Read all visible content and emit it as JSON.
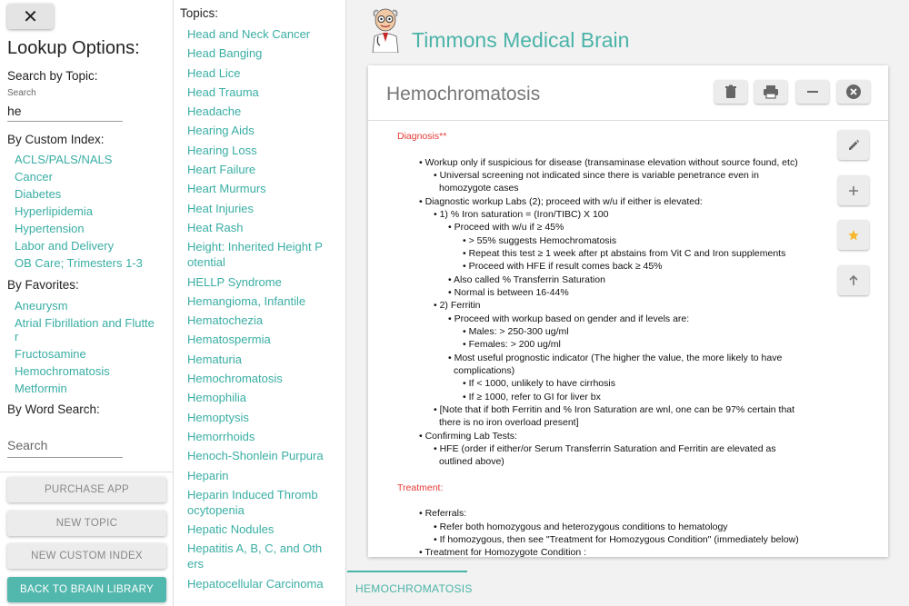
{
  "left": {
    "close_label": "✕",
    "title": "Lookup Options:",
    "search_topic_label": "Search by Topic:",
    "search_small_label": "Search",
    "search_value": "he",
    "custom_index_label": "By Custom Index:",
    "custom_index_items": [
      "ACLS/PALS/NALS",
      "Cancer",
      "Diabetes",
      "Hyperlipidemia",
      "Hypertension",
      "Labor and Delivery",
      "OB Care; Trimesters 1-3"
    ],
    "favorites_label": "By Favorites:",
    "favorites_items": [
      "Aneurysm",
      "Atrial Fibrillation and Flutter",
      "Fructosamine",
      "Hemochromatosis",
      "Metformin"
    ],
    "word_search_label": "By Word Search:",
    "word_search_placeholder": "Search",
    "buttons": {
      "purchase": "PURCHASE APP",
      "new_topic": "NEW TOPIC",
      "new_custom_index": "NEW CUSTOM INDEX",
      "back": "BACK TO BRAIN LIBRARY"
    }
  },
  "topics": {
    "title": "Topics:",
    "items": [
      "Head and Neck Cancer",
      "Head Banging",
      "Head Lice",
      "Head Trauma",
      "Headache",
      "Hearing Aids",
      "Hearing Loss",
      "Heart Failure",
      "Heart Murmurs",
      "Heat Injuries",
      "Heat Rash",
      "Height: Inherited Height Potential",
      "HELLP Syndrome",
      "Hemangioma, Infantile",
      "Hematochezia",
      "Hematospermia",
      "Hematuria",
      "Hemochromatosis",
      "Hemophilia",
      "Hemoptysis",
      "Hemorrhoids",
      "Henoch-Shonlein Purpura",
      "Heparin",
      "Heparin Induced Thrombocytopenia",
      "Hepatic Nodules",
      "Hepatitis A, B, C, and Others",
      "Hepatocellular Carcinoma"
    ]
  },
  "main": {
    "app_title": "Timmons Medical Brain",
    "card_title": "Hemochromatosis",
    "tab_label": "HEMOCHROMATOSIS",
    "header_icons": [
      "trash-icon",
      "print-icon",
      "minimize-icon",
      "close-circle-icon"
    ],
    "side_icons": [
      "edit-icon",
      "add-icon",
      "star-icon",
      "arrow-up-icon"
    ],
    "star_color": "#f5b82e",
    "accent": "#4ab3a8",
    "note": {
      "l01": "Diagnosis**",
      "l02": "Workup only if suspicious for disease (transaminase elevation without source found, etc)",
      "l03": "Universal screening not indicated since there is variable penetrance even in",
      "l04": "homozygote cases",
      "l05": "Diagnostic workup Labs (2); proceed with w/u if either is elevated:",
      "l06": "1) % Iron saturation = (Iron/TIBC) X 100",
      "l07": "Proceed with w/u if ≥ 45%",
      "l08": "> 55% suggests Hemochromatosis",
      "l09": "Repeat this test ≥ 1 week after pt abstains from Vit C and Iron supplements",
      "l10": "Proceed with HFE if result comes back ≥ 45%",
      "l11": "Also called % Transferrin Saturation",
      "l12": "Normal is between 16-44%",
      "l13": "2) Ferritin",
      "l14": "Proceed with workup based on gender and if levels are:",
      "l15": "Males: > 250-300 ug/ml",
      "l16": "Females: > 200 ug/ml",
      "l17": "Most useful prognostic indicator (The higher the value, the more likely to have",
      "l18": "complications)",
      "l19": "If < 1000, unlikely to have cirrhosis",
      "l20": "If ≥ 1000, refer to GI for liver bx",
      "l21": "[Note that if both Ferritin and % Iron Saturation are wnl, one can be 97% certain that",
      "l22": "there is no iron overload present]",
      "l23": "Confirming Lab Tests:",
      "l24": "HFE (order if either/or Serum Transferrin Saturation and Ferritin are elevated as",
      "l25": "outlined above)",
      "l26": "Treatment:",
      "l27": "Referrals:",
      "l28": "Refer both homozygous and heterozygous conditions to hematology",
      "l29": "If homozygous, then see \"Treatment for Homozygous Condition\" (immediately below)",
      "l30": "Treatment for Homozygote Condition :"
    }
  }
}
